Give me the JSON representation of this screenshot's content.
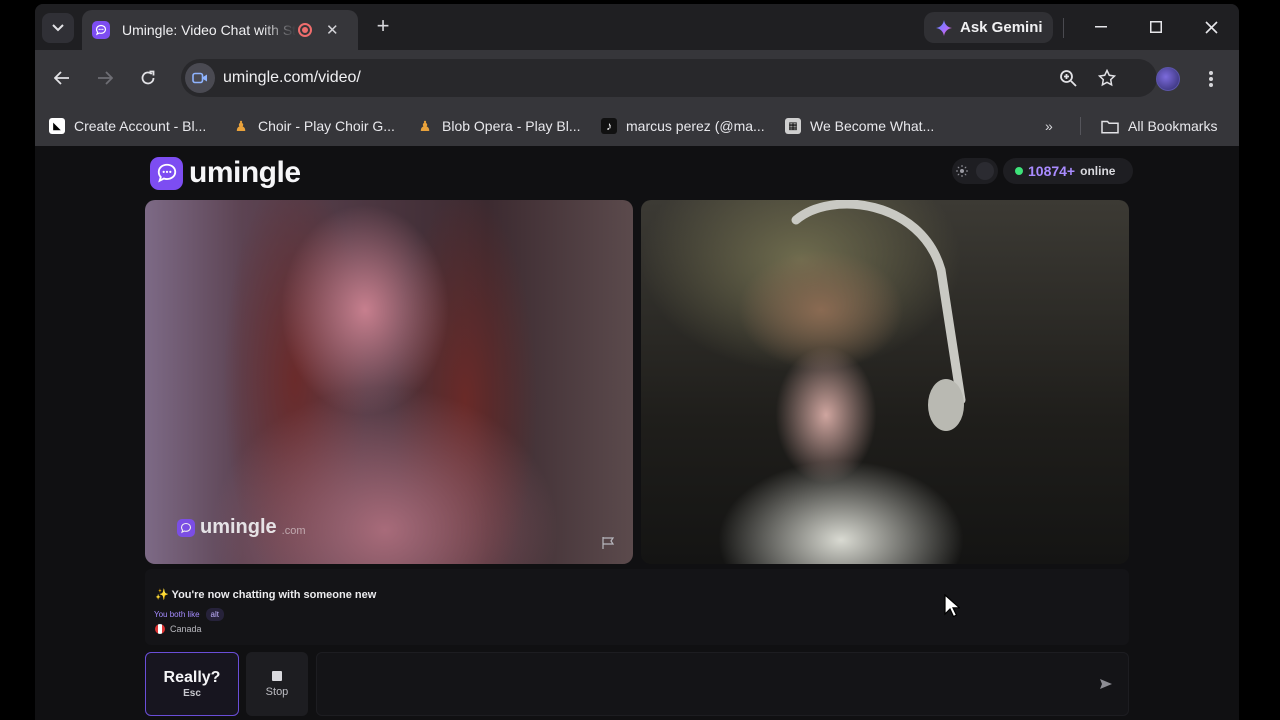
{
  "browser": {
    "tab": {
      "title": "Umingle: Video Chat with Strangers"
    },
    "gemini_label": "Ask Gemini",
    "url": "umingle.com/video/",
    "bookmarks": [
      {
        "label": "Create Account - Bl...",
        "icon": "bluesky-icon",
        "color": "#ffffff"
      },
      {
        "label": "Choir - Play Choir G...",
        "icon": "choir-icon",
        "color": "#e9a23b"
      },
      {
        "label": "Blob Opera - Play Bl...",
        "icon": "blob-opera-icon",
        "color": "#e9a23b"
      },
      {
        "label": "marcus perez (@ma...",
        "icon": "tiktok-icon",
        "color": "#111111"
      },
      {
        "label": "We Become What...",
        "icon": "game-icon",
        "color": "#cfcfcf"
      }
    ],
    "all_bookmarks_label": "All Bookmarks"
  },
  "site": {
    "logo_text": "umingle",
    "online_count": "10874+",
    "online_label": "online",
    "accent_color": "#7d4df2",
    "watermark_text": "umingle",
    "watermark_suffix": ".com"
  },
  "chat": {
    "status": "✨ You're now chatting with someone new",
    "both_like_label": "You both like",
    "shared_interest": "alt",
    "country": "Canada"
  },
  "controls": {
    "really_label": "Really?",
    "esc_label": "Esc",
    "stop_label": "Stop",
    "message_placeholder": ""
  }
}
